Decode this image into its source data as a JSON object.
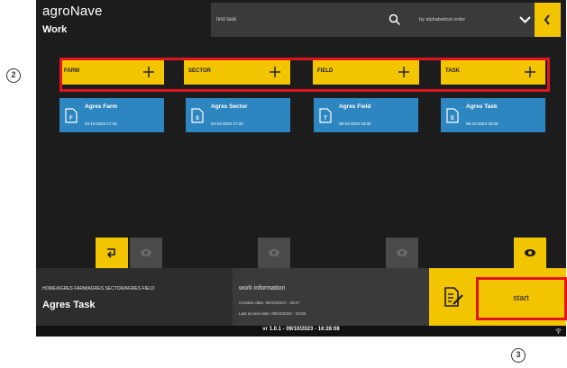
{
  "header": {
    "brand_part1": "agro",
    "brand_part2": "Nave",
    "section": "Work",
    "search_placeholder": "find task",
    "sort_label": "by alphabetical order"
  },
  "categories": [
    {
      "label": "FARM"
    },
    {
      "label": "SECTOR"
    },
    {
      "label": "FIELD"
    },
    {
      "label": "TASK"
    }
  ],
  "cards": [
    {
      "letter": "F",
      "title": "Agres Farm",
      "date": "04-10-2023 17:33"
    },
    {
      "letter": "S",
      "title": "Agres Sector",
      "date": "04-10-2023 17:33"
    },
    {
      "letter": "T",
      "title": "Agres Field",
      "date": "09-10-2023 19:05"
    },
    {
      "letter": "E",
      "title": "Agres Task",
      "date": "09-10-2023 19:05"
    }
  ],
  "footer": {
    "path": "HOME/AGRES FARM/AGRES SECTOR/AGRES FIELD",
    "current_title": "Agres Task",
    "info_title": "work information",
    "creation": "Creation date: 09/10/2023 - 16:37",
    "last_access": "Last access date: 09/10/2023 - 19:05",
    "start_label": "start"
  },
  "version": "vr 1.0.1 - 09/10/2023 - 16:28:08",
  "callouts": {
    "one": "2",
    "two": "3"
  },
  "colors": {
    "background": "#1c1c1c",
    "accent_yellow": "#f3c400",
    "card_blue": "#2e86c1",
    "highlight_red": "#e0141e",
    "panel_gray": "#3a3a3a"
  },
  "icons": [
    "search-icon",
    "chevron-down-icon",
    "back-arrow-icon",
    "plus-icon",
    "file-icon",
    "swap-icon",
    "eye-icon",
    "edit-document-icon",
    "wifi-icon"
  ]
}
